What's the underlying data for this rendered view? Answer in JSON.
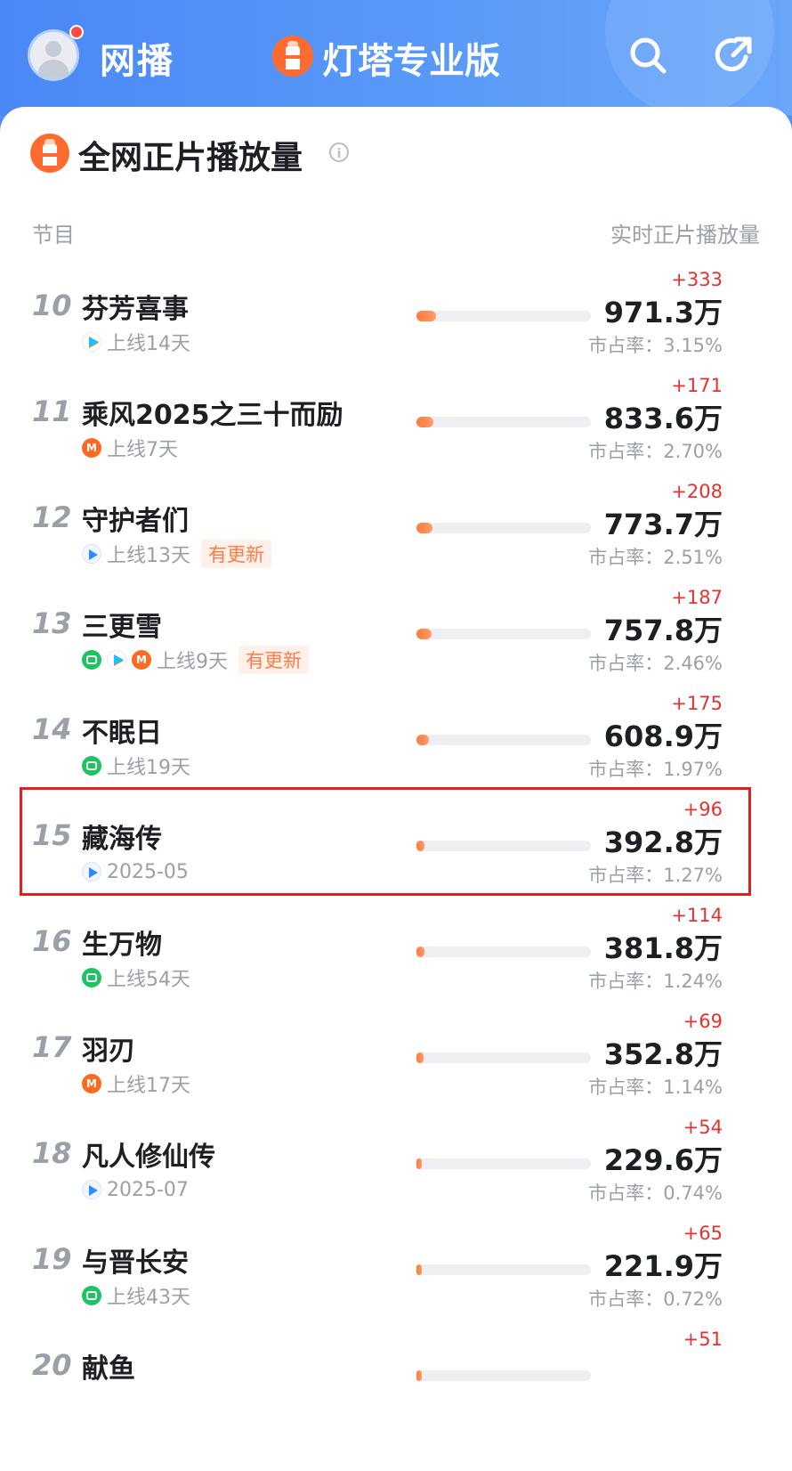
{
  "header": {
    "tab_web": "网播",
    "tab_pro": "灯塔专业版"
  },
  "section": {
    "title": "全网正片播放量",
    "info": "i",
    "col_left": "节目",
    "col_right": "实时正片播放量"
  },
  "colors": {
    "header_blue": "#4f8ff7",
    "bar_orange": "#ff7a3d",
    "delta_red": "#e6322f",
    "highlight_red": "#e02020"
  },
  "rows": [
    {
      "rank": "10",
      "name": "芬芳喜事",
      "platforms": [
        "youku"
      ],
      "status": "上线14天",
      "tag": "",
      "delta": "+333",
      "value": "971.3万",
      "share": "市占率：3.15%",
      "share_pct": 3.15
    },
    {
      "rank": "11",
      "name": "乘风2025之三十而励",
      "platforms": [
        "mgtv"
      ],
      "status": "上线7天",
      "tag": "",
      "delta": "+171",
      "value": "833.6万",
      "share": "市占率：2.70%",
      "share_pct": 2.7
    },
    {
      "rank": "12",
      "name": "守护者们",
      "platforms": [
        "tencent"
      ],
      "status": "上线13天",
      "tag": "有更新",
      "delta": "+208",
      "value": "773.7万",
      "share": "市占率：2.51%",
      "share_pct": 2.51
    },
    {
      "rank": "13",
      "name": "三更雪",
      "platforms": [
        "iqiyi",
        "youku",
        "mgtv"
      ],
      "status": "上线9天",
      "tag": "有更新",
      "delta": "+187",
      "value": "757.8万",
      "share": "市占率：2.46%",
      "share_pct": 2.46
    },
    {
      "rank": "14",
      "name": "不眠日",
      "platforms": [
        "iqiyi"
      ],
      "status": "上线19天",
      "tag": "",
      "delta": "+175",
      "value": "608.9万",
      "share": "市占率：1.97%",
      "share_pct": 1.97
    },
    {
      "rank": "15",
      "name": "藏海传",
      "platforms": [
        "tencent"
      ],
      "status": "2025-05",
      "tag": "",
      "delta": "+96",
      "value": "392.8万",
      "share": "市占率：1.27%",
      "share_pct": 1.27
    },
    {
      "rank": "16",
      "name": "生万物",
      "platforms": [
        "iqiyi"
      ],
      "status": "上线54天",
      "tag": "",
      "delta": "+114",
      "value": "381.8万",
      "share": "市占率：1.24%",
      "share_pct": 1.24
    },
    {
      "rank": "17",
      "name": "羽刃",
      "platforms": [
        "mgtv"
      ],
      "status": "上线17天",
      "tag": "",
      "delta": "+69",
      "value": "352.8万",
      "share": "市占率：1.14%",
      "share_pct": 1.14
    },
    {
      "rank": "18",
      "name": "凡人修仙传",
      "platforms": [
        "tencent"
      ],
      "status": "2025-07",
      "tag": "",
      "delta": "+54",
      "value": "229.6万",
      "share": "市占率：0.74%",
      "share_pct": 0.74
    },
    {
      "rank": "19",
      "name": "与晋长安",
      "platforms": [
        "iqiyi"
      ],
      "status": "上线43天",
      "tag": "",
      "delta": "+65",
      "value": "221.9万",
      "share": "市占率：0.72%",
      "share_pct": 0.72
    },
    {
      "rank": "20",
      "name": "献鱼",
      "platforms": [],
      "status": "",
      "tag": "",
      "delta": "+51",
      "value": "",
      "share": "",
      "share_pct": 0.7
    }
  ]
}
